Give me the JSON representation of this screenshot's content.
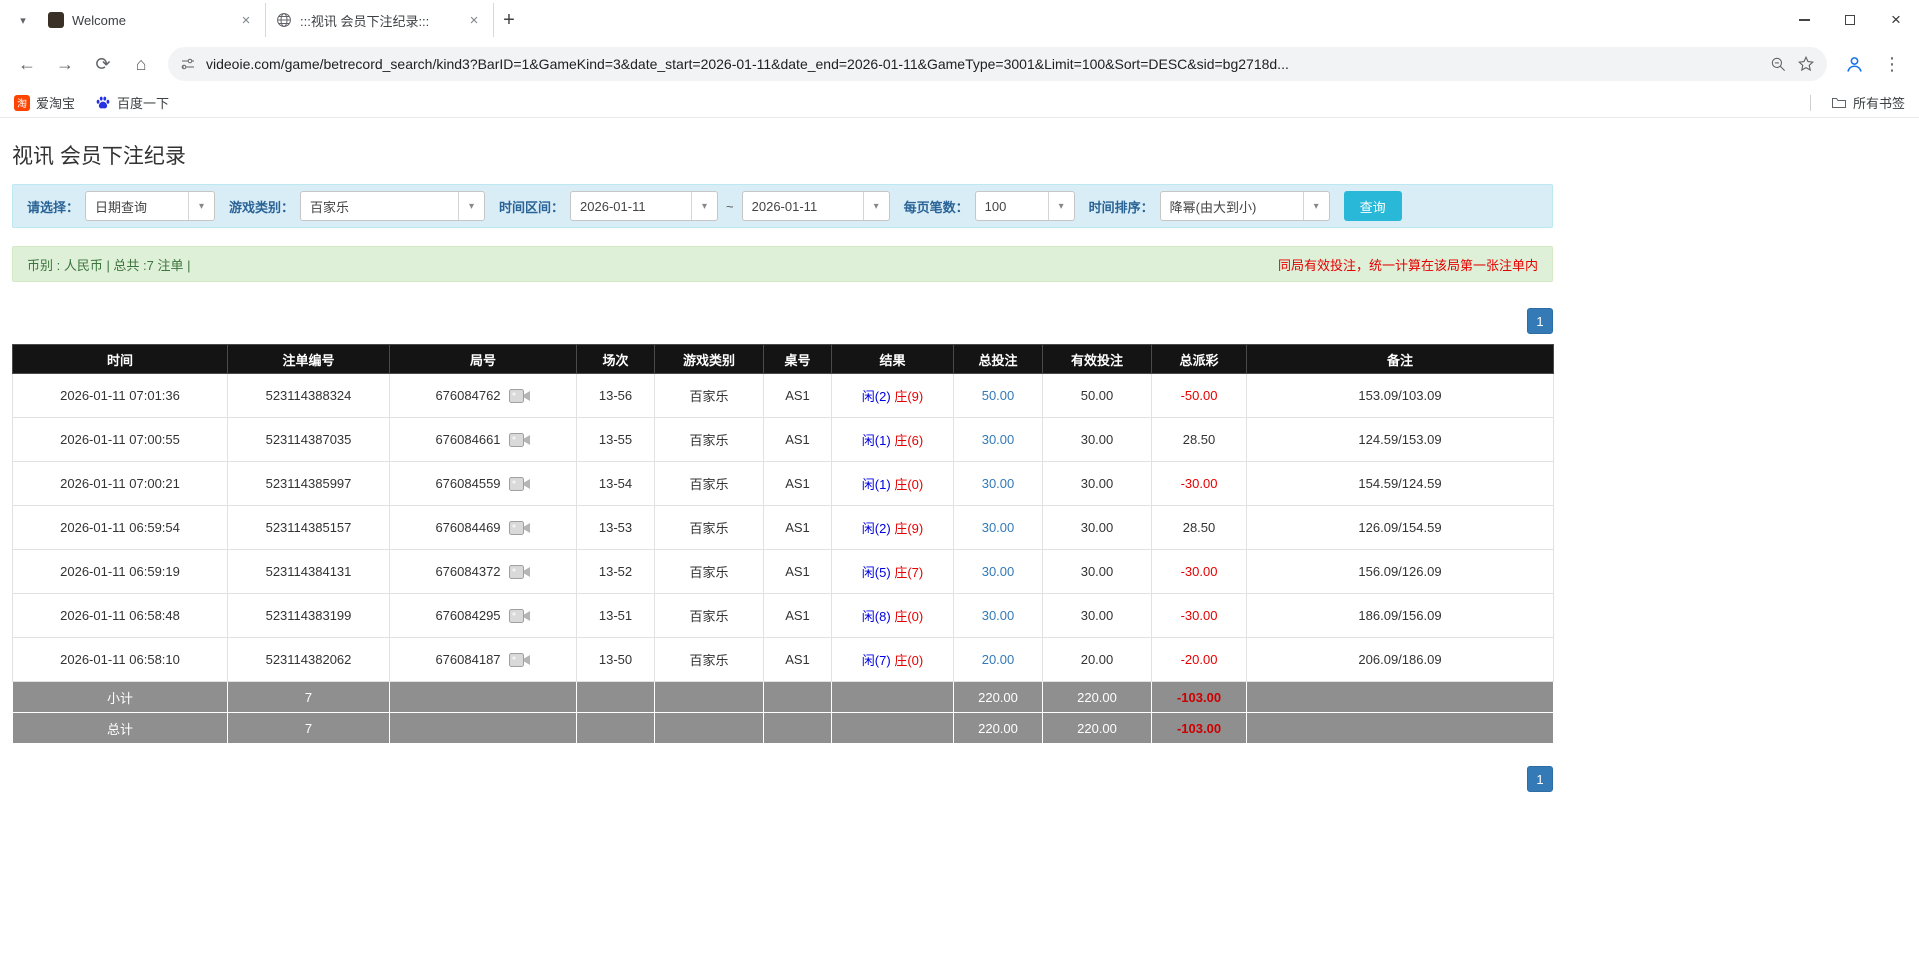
{
  "browser": {
    "tabs": [
      {
        "label": "Welcome"
      },
      {
        "label": ":::视讯 会员下注纪录:::"
      }
    ],
    "url": "videoie.com/game/betrecord_search/kind3?BarID=1&GameKind=3&date_start=2026-01-11&date_end=2026-01-11&GameType=3001&Limit=100&Sort=DESC&sid=bg2718d...",
    "bookmarks": [
      {
        "label": "爱淘宝"
      },
      {
        "label": "百度一下"
      }
    ],
    "all_bookmarks_label": "所有书签"
  },
  "page": {
    "title": "视讯 会员下注纪录",
    "filters": {
      "select_label": "请选择：",
      "select_value": "日期查询",
      "game_type_label": "游戏类别：",
      "game_type_value": "百家乐",
      "date_range_label": "时间区间：",
      "date_start": "2026-01-11",
      "date_separator": "~",
      "date_end": "2026-01-11",
      "per_page_label": "每页笔数：",
      "per_page_value": "100",
      "sort_label": "时间排序：",
      "sort_value": "降幂(由大到小)",
      "search_button": "查询"
    },
    "summary": {
      "left": "币别 : 人民币 | 总共 :7 注单 |",
      "right": "同局有效投注，统一计算在该局第一张注单内"
    },
    "pagination": "1",
    "colors": {
      "accent_blue": "#337ab7",
      "search_button": "#29b8d8",
      "player_blue": "#0000e0",
      "banker_red": "#e60000",
      "header_black": "#141414",
      "footer_gray": "#8f8f8f"
    },
    "table": {
      "headers": [
        "时间",
        "注单编号",
        "局号",
        "场次",
        "游戏类别",
        "桌号",
        "结果",
        "总投注",
        "有效投注",
        "总派彩",
        "备注"
      ],
      "rows": [
        {
          "time": "2026-01-11 07:01:36",
          "bet_id": "523114388324",
          "round_id": "676084762",
          "session": "13-56",
          "game": "百家乐",
          "table": "AS1",
          "player": "闲(2)",
          "banker": "庄(9)",
          "total_bet": "50.00",
          "valid_bet": "50.00",
          "payout": "-50.00",
          "remark": "153.09/103.09"
        },
        {
          "time": "2026-01-11 07:00:55",
          "bet_id": "523114387035",
          "round_id": "676084661",
          "session": "13-55",
          "game": "百家乐",
          "table": "AS1",
          "player": "闲(1)",
          "banker": "庄(6)",
          "total_bet": "30.00",
          "valid_bet": "30.00",
          "payout": "28.50",
          "remark": "124.59/153.09"
        },
        {
          "time": "2026-01-11 07:00:21",
          "bet_id": "523114385997",
          "round_id": "676084559",
          "session": "13-54",
          "game": "百家乐",
          "table": "AS1",
          "player": "闲(1)",
          "banker": "庄(0)",
          "total_bet": "30.00",
          "valid_bet": "30.00",
          "payout": "-30.00",
          "remark": "154.59/124.59"
        },
        {
          "time": "2026-01-11 06:59:54",
          "bet_id": "523114385157",
          "round_id": "676084469",
          "session": "13-53",
          "game": "百家乐",
          "table": "AS1",
          "player": "闲(2)",
          "banker": "庄(9)",
          "total_bet": "30.00",
          "valid_bet": "30.00",
          "payout": "28.50",
          "remark": "126.09/154.59"
        },
        {
          "time": "2026-01-11 06:59:19",
          "bet_id": "523114384131",
          "round_id": "676084372",
          "session": "13-52",
          "game": "百家乐",
          "table": "AS1",
          "player": "闲(5)",
          "banker": "庄(7)",
          "total_bet": "30.00",
          "valid_bet": "30.00",
          "payout": "-30.00",
          "remark": "156.09/126.09"
        },
        {
          "time": "2026-01-11 06:58:48",
          "bet_id": "523114383199",
          "round_id": "676084295",
          "session": "13-51",
          "game": "百家乐",
          "table": "AS1",
          "player": "闲(8)",
          "banker": "庄(0)",
          "total_bet": "30.00",
          "valid_bet": "30.00",
          "payout": "-30.00",
          "remark": "186.09/156.09"
        },
        {
          "time": "2026-01-11 06:58:10",
          "bet_id": "523114382062",
          "round_id": "676084187",
          "session": "13-50",
          "game": "百家乐",
          "table": "AS1",
          "player": "闲(7)",
          "banker": "庄(0)",
          "total_bet": "20.00",
          "valid_bet": "20.00",
          "payout": "-20.00",
          "remark": "206.09/186.09"
        }
      ],
      "subtotal": {
        "label": "小计",
        "count": "7",
        "total_bet": "220.00",
        "valid_bet": "220.00",
        "payout": "-103.00"
      },
      "total": {
        "label": "总计",
        "count": "7",
        "total_bet": "220.00",
        "valid_bet": "220.00",
        "payout": "-103.00"
      }
    }
  }
}
